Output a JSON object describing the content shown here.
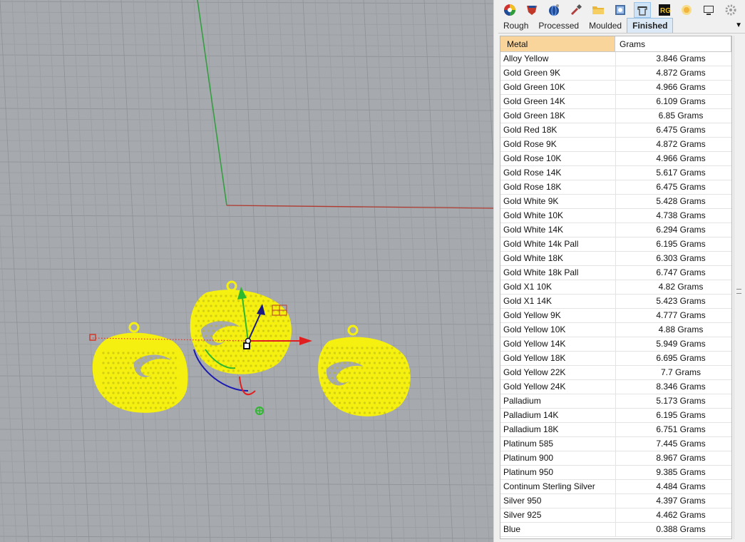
{
  "toolbar": {
    "icons": [
      {
        "name": "color-wheel-icon",
        "color": "#d0332e"
      },
      {
        "name": "shield-icon",
        "color": "#c0392b"
      },
      {
        "name": "globe-icon",
        "color": "#1f4d9a"
      },
      {
        "name": "eyedropper-icon",
        "color": "#b04040"
      },
      {
        "name": "folder-icon",
        "color": "#e8b73c"
      },
      {
        "name": "image-icon",
        "color": "#4a6fa5"
      },
      {
        "name": "ring-icon",
        "color": "#666666"
      },
      {
        "name": "rg-logo-icon",
        "color": "#f0c020"
      },
      {
        "name": "sun-icon",
        "color": "#f3b43c"
      },
      {
        "name": "monitor-icon",
        "color": "#333333"
      },
      {
        "name": "settings-icon",
        "color": "#888888"
      }
    ]
  },
  "tabs": [
    {
      "label": "Rough"
    },
    {
      "label": "Processed"
    },
    {
      "label": "Moulded"
    },
    {
      "label": "Finished",
      "active": true
    }
  ],
  "table": {
    "headers": {
      "metal": "Metal",
      "grams": "Grams"
    },
    "rows": [
      {
        "metal": "Alloy Yellow",
        "grams": "3.846 Grams"
      },
      {
        "metal": "Gold Green 9K",
        "grams": "4.872 Grams"
      },
      {
        "metal": "Gold Green 10K",
        "grams": "4.966 Grams"
      },
      {
        "metal": "Gold Green 14K",
        "grams": "6.109 Grams"
      },
      {
        "metal": "Gold Green 18K",
        "grams": "6.85 Grams"
      },
      {
        "metal": "Gold Red 18K",
        "grams": "6.475 Grams"
      },
      {
        "metal": "Gold Rose 9K",
        "grams": "4.872 Grams"
      },
      {
        "metal": "Gold Rose 10K",
        "grams": "4.966 Grams"
      },
      {
        "metal": "Gold Rose 14K",
        "grams": "5.617 Grams"
      },
      {
        "metal": "Gold Rose 18K",
        "grams": "6.475 Grams"
      },
      {
        "metal": "Gold White 9K",
        "grams": "5.428 Grams"
      },
      {
        "metal": "Gold White 10K",
        "grams": "4.738 Grams"
      },
      {
        "metal": "Gold White 14K",
        "grams": "6.294 Grams"
      },
      {
        "metal": "Gold White 14k Pall",
        "grams": "6.195 Grams"
      },
      {
        "metal": "Gold White 18K",
        "grams": "6.303 Grams"
      },
      {
        "metal": "Gold White 18k Pall",
        "grams": "6.747 Grams"
      },
      {
        "metal": "Gold X1 10K",
        "grams": "4.82 Grams"
      },
      {
        "metal": "Gold X1 14K",
        "grams": "5.423 Grams"
      },
      {
        "metal": "Gold Yellow 9K",
        "grams": "4.777 Grams"
      },
      {
        "metal": "Gold Yellow 10K",
        "grams": "4.88 Grams"
      },
      {
        "metal": "Gold Yellow 14K",
        "grams": "5.949 Grams"
      },
      {
        "metal": "Gold Yellow 18K",
        "grams": "6.695 Grams"
      },
      {
        "metal": "Gold Yellow 22K",
        "grams": "7.7 Grams"
      },
      {
        "metal": "Gold Yellow 24K",
        "grams": "8.346 Grams"
      },
      {
        "metal": "Palladium",
        "grams": "5.173 Grams"
      },
      {
        "metal": "Palladium 14K",
        "grams": "6.195 Grams"
      },
      {
        "metal": "Palladium 18K",
        "grams": "6.751 Grams"
      },
      {
        "metal": "Platinum 585",
        "grams": "7.445 Grams"
      },
      {
        "metal": "Platinum 900",
        "grams": "8.967 Grams"
      },
      {
        "metal": "Platinum 950",
        "grams": "9.385 Grams"
      },
      {
        "metal": "Continum Sterling Silver",
        "grams": "4.484 Grams"
      },
      {
        "metal": "Silver 950",
        "grams": "4.397 Grams"
      },
      {
        "metal": "Silver 925",
        "grams": "4.462 Grams"
      },
      {
        "metal": "Blue",
        "grams": "0.388 Grams"
      }
    ]
  },
  "viewport": {
    "colors": {
      "background": "#a6a9ad",
      "object": "#f5f00f",
      "x_axis": "#c0392b",
      "y_axis": "#2e9e3a",
      "z_axis": "#1a1ab0"
    }
  }
}
